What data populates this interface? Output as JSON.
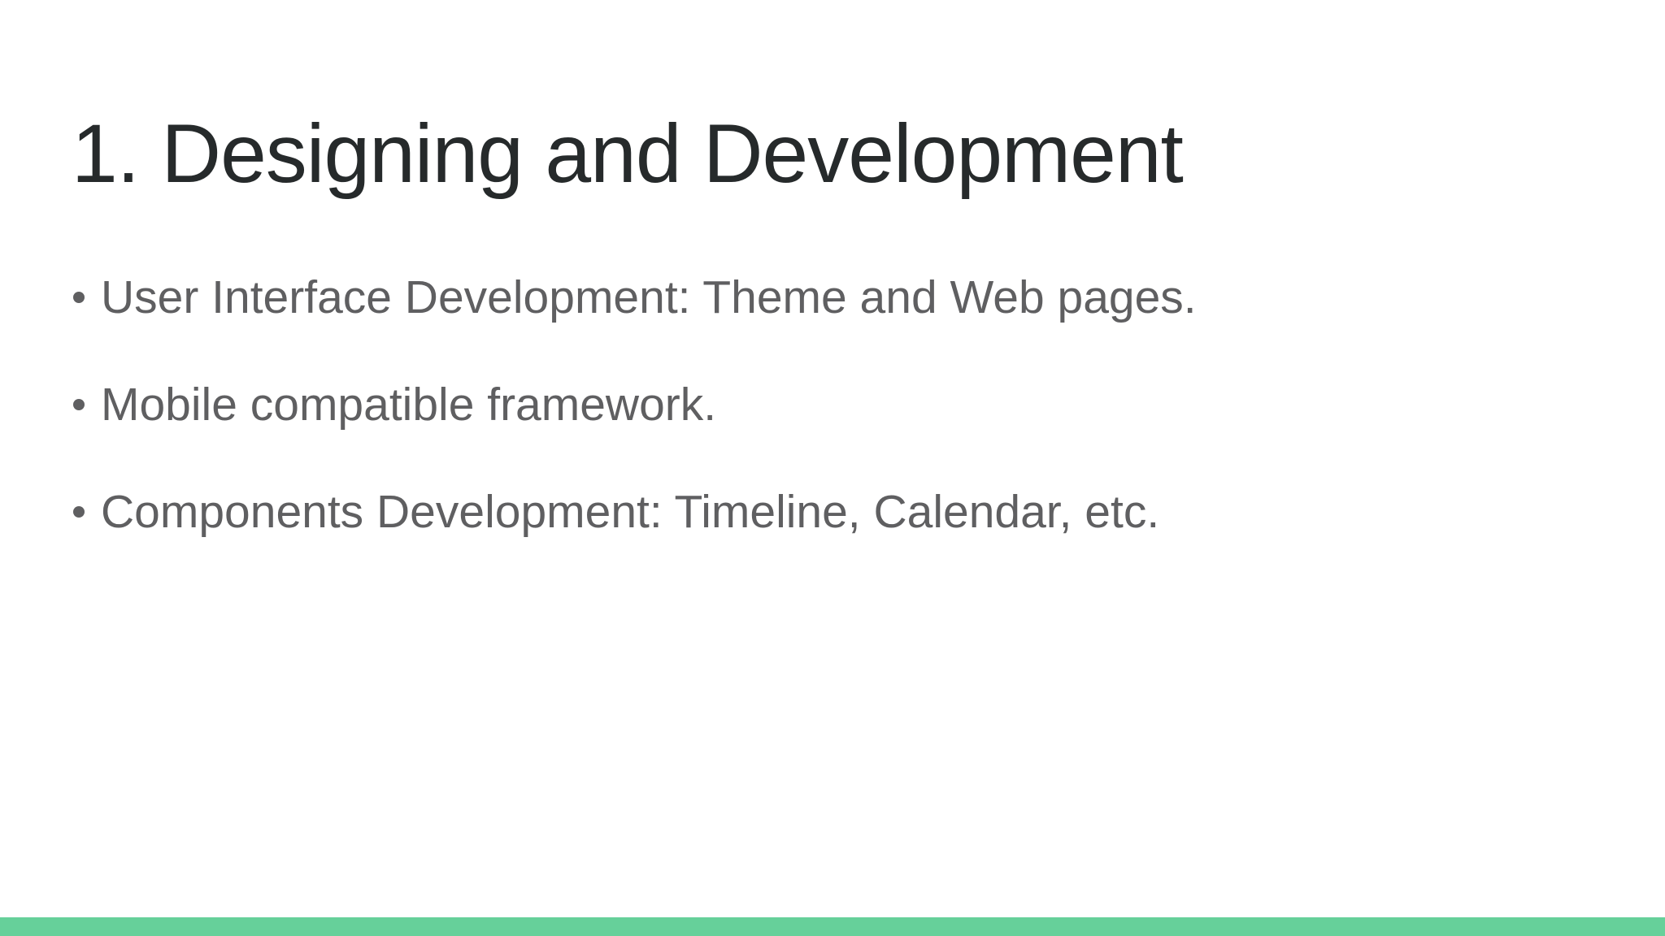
{
  "slide": {
    "title": "1. Designing and Development",
    "bullets": [
      "User Interface Development: Theme and Web pages.",
      "Mobile compatible framework.",
      "Components Development: Timeline, Calendar, etc."
    ]
  },
  "colors": {
    "title": "#262a2b",
    "body": "#5f5f61",
    "accent_bar": "#66d09a",
    "background": "#ffffff"
  }
}
